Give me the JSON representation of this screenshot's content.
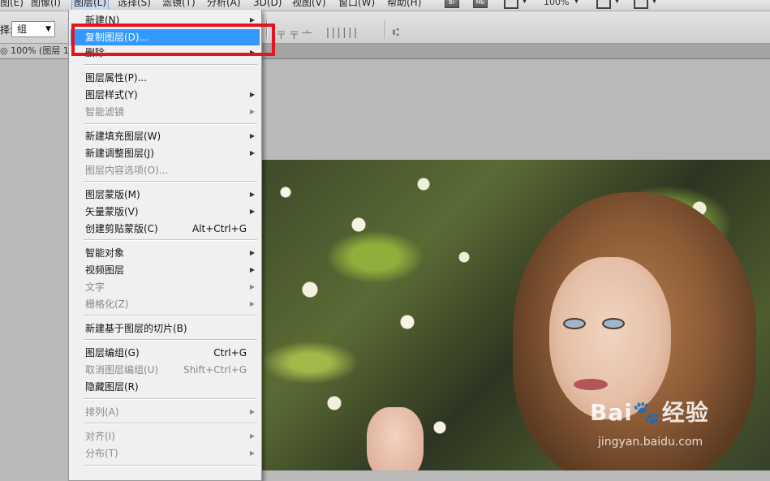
{
  "menubar": {
    "items": [
      "图(E)",
      "图像(I)",
      "图层(L)",
      "选择(S)",
      "滤镜(T)",
      "分析(A)",
      "3D(D)",
      "视图(V)",
      "窗口(W)",
      "帮助(H)"
    ],
    "br": "Br",
    "mb": "Mb",
    "zoom": "100%"
  },
  "options": {
    "label": "择:",
    "select_value": "组"
  },
  "doctab": {
    "label": "◎ 100% (图层 1"
  },
  "layer_menu": {
    "items": [
      {
        "label": "新建(N)",
        "shortcut": "",
        "submenu": true,
        "disabled": false,
        "highlight": false
      },
      {
        "label": "复制图层(D)...",
        "shortcut": "",
        "submenu": false,
        "disabled": false,
        "highlight": true
      },
      {
        "label": "删除",
        "shortcut": "",
        "submenu": true,
        "disabled": false,
        "highlight": false
      },
      {
        "label": "图层属性(P)...",
        "shortcut": "",
        "submenu": false,
        "disabled": false,
        "highlight": false
      },
      {
        "label": "图层样式(Y)",
        "shortcut": "",
        "submenu": true,
        "disabled": false,
        "highlight": false
      },
      {
        "label": "智能滤镜",
        "shortcut": "",
        "submenu": true,
        "disabled": true,
        "highlight": false
      },
      {
        "label": "新建填充图层(W)",
        "shortcut": "",
        "submenu": true,
        "disabled": false,
        "highlight": false
      },
      {
        "label": "新建调整图层(J)",
        "shortcut": "",
        "submenu": true,
        "disabled": false,
        "highlight": false
      },
      {
        "label": "图层内容选项(O)...",
        "shortcut": "",
        "submenu": false,
        "disabled": true,
        "highlight": false
      },
      {
        "label": "图层蒙版(M)",
        "shortcut": "",
        "submenu": true,
        "disabled": false,
        "highlight": false
      },
      {
        "label": "矢量蒙版(V)",
        "shortcut": "",
        "submenu": true,
        "disabled": false,
        "highlight": false
      },
      {
        "label": "创建剪贴蒙版(C)",
        "shortcut": "Alt+Ctrl+G",
        "submenu": false,
        "disabled": false,
        "highlight": false
      },
      {
        "label": "智能对象",
        "shortcut": "",
        "submenu": true,
        "disabled": false,
        "highlight": false
      },
      {
        "label": "视频图层",
        "shortcut": "",
        "submenu": true,
        "disabled": false,
        "highlight": false
      },
      {
        "label": "文字",
        "shortcut": "",
        "submenu": true,
        "disabled": true,
        "highlight": false
      },
      {
        "label": "栅格化(Z)",
        "shortcut": "",
        "submenu": true,
        "disabled": true,
        "highlight": false
      },
      {
        "label": "新建基于图层的切片(B)",
        "shortcut": "",
        "submenu": false,
        "disabled": false,
        "highlight": false
      },
      {
        "label": "图层编组(G)",
        "shortcut": "Ctrl+G",
        "submenu": false,
        "disabled": false,
        "highlight": false
      },
      {
        "label": "取消图层编组(U)",
        "shortcut": "Shift+Ctrl+G",
        "submenu": false,
        "disabled": true,
        "highlight": false
      },
      {
        "label": "隐藏图层(R)",
        "shortcut": "",
        "submenu": false,
        "disabled": false,
        "highlight": false
      },
      {
        "label": "排列(A)",
        "shortcut": "",
        "submenu": true,
        "disabled": true,
        "highlight": false
      },
      {
        "label": "对齐(I)",
        "shortcut": "",
        "submenu": true,
        "disabled": true,
        "highlight": false
      },
      {
        "label": "分布(T)",
        "shortcut": "",
        "submenu": true,
        "disabled": true,
        "highlight": false
      }
    ]
  },
  "watermark": {
    "brand": "Bai🐾经验",
    "url": "jingyan.baidu.com"
  },
  "colors": {
    "highlight": "#3399ff",
    "annotation_box": "#e3151c"
  }
}
